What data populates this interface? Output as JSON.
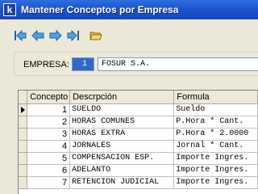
{
  "window": {
    "title": "Mantener Conceptos por Empresa",
    "icon_letter": "k"
  },
  "toolbar": {
    "buttons": [
      {
        "icon": "first-record-icon"
      },
      {
        "icon": "previous-record-icon"
      },
      {
        "icon": "next-record-icon"
      },
      {
        "icon": "last-record-icon"
      },
      {
        "icon": "open-folder-icon"
      }
    ]
  },
  "empresa": {
    "label": "EMPRESA:",
    "code": "1",
    "name": "FOSUR S.A."
  },
  "grid": {
    "columns": [
      "Concepto",
      "Descrpción",
      "Formula"
    ],
    "rows": [
      {
        "concepto": "1",
        "descripcion": "SUELDO",
        "formula": "Sueldo"
      },
      {
        "concepto": "2",
        "descripcion": "HORAS COMUNES",
        "formula": "P.Hora * Cant."
      },
      {
        "concepto": "3",
        "descripcion": "HORAS EXTRA",
        "formula": "P.Hora * 2.0000"
      },
      {
        "concepto": "4",
        "descripcion": "JORNALES",
        "formula": "Jornal * Cant."
      },
      {
        "concepto": "5",
        "descripcion": "COMPENSACION ESP.",
        "formula": "Importe Ingres."
      },
      {
        "concepto": "6",
        "descripcion": "ADELANTO",
        "formula": "Importe Ingres."
      },
      {
        "concepto": "7",
        "descripcion": "RETENCION JUDICIAL",
        "formula": "Importe Ingres."
      }
    ],
    "current_row": 0
  }
}
